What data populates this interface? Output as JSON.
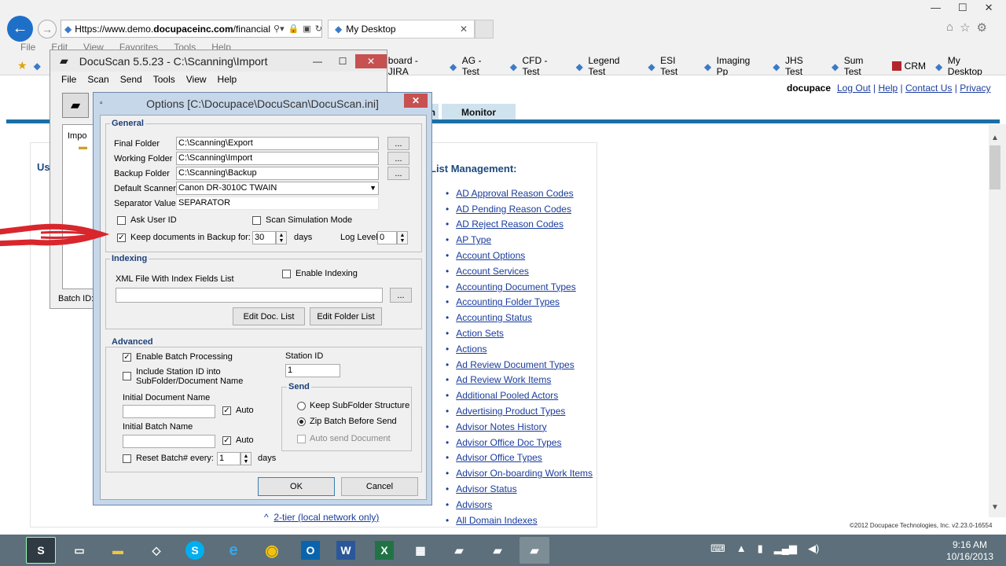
{
  "browser": {
    "address_prefix": "Https://www.demo.",
    "address_domain": "docupaceinc.com",
    "address_suffix": "/financial",
    "tab_title": "My Desktop",
    "menu": [
      "File",
      "Edit",
      "View",
      "Favorites",
      "Tools",
      "Help"
    ],
    "favorites": [
      "board - JIRA",
      "AG - Test",
      "CFD - Test",
      "Legend Test",
      "ESI Test",
      "Imaging Pp",
      "JHS Test",
      "Sum Test",
      "CRM",
      "My Desktop"
    ]
  },
  "page": {
    "brand": "docupace",
    "links": [
      "Log Out",
      "Help",
      "Contact Us",
      "Privacy"
    ],
    "separator": "|",
    "tab_partial": "n",
    "tab_monitor": "Monitor",
    "left_partial": "Us",
    "list_title": "List Management:",
    "list_items": [
      "AD Approval Reason Codes",
      "AD Pending Reason Codes",
      "AD Reject Reason Codes",
      "AP Type",
      "Account Options",
      "Account Services",
      "Accounting Document Types",
      "Accounting Folder Types",
      "Accounting Status",
      "Action Sets",
      "Actions",
      "Ad Review Document Types",
      "Ad Review Work Items",
      "Additional Pooled Actors",
      "Advertising Product Types",
      "Advisor Notes History",
      "Advisor Office Doc Types",
      "Advisor Office Types",
      "Advisor On-boarding Work Items",
      "Advisor Status",
      "Advisors",
      "All Domain Indexes"
    ],
    "two_tier": "2-tier (local network only)",
    "copyright": "©2012 Docupace Technologies, Inc. v2.23.0-16554"
  },
  "docuscan": {
    "title": "DocuScan 5.5.23 - C:\\Scanning\\Import",
    "menu": [
      "File",
      "Scan",
      "Send",
      "Tools",
      "View",
      "Help"
    ],
    "tree_item": "Impo",
    "batch_id": "Batch ID:"
  },
  "options": {
    "title": "Options [C:\\Docupace\\DocuScan\\DocuScan.ini]",
    "general": {
      "label": "General",
      "final_folder_label": "Final Folder",
      "final_folder": "C:\\Scanning\\Export",
      "working_folder_label": "Working Folder",
      "working_folder": "C:\\Scanning\\Import",
      "backup_folder_label": "Backup Folder",
      "backup_folder": "C:\\Scanning\\Backup",
      "default_scanner_label": "Default Scanner",
      "default_scanner": "Canon DR-3010C TWAIN",
      "separator_label": "Separator Value",
      "separator": "SEPARATOR",
      "ask_user_id": "Ask User ID",
      "scan_sim": "Scan Simulation Mode",
      "keep_docs": "Keep documents in Backup for:",
      "keep_days": "30",
      "days": "days",
      "log_level_label": "Log Level",
      "log_level": "0",
      "browse": "..."
    },
    "indexing": {
      "label": "Indexing",
      "xml_label": "XML File With Index Fields List",
      "enable": "Enable Indexing",
      "edit_doc": "Edit Doc. List",
      "edit_folder": "Edit Folder List"
    },
    "advanced": {
      "label": "Advanced",
      "enable_batch": "Enable Batch Processing",
      "include_station_1": "Include Station ID into",
      "include_station_2": "SubFolder/Document Name",
      "station_id_label": "Station ID",
      "station_id": "1",
      "initial_doc_label": "Initial Document Name",
      "auto": "Auto",
      "initial_batch_label": "Initial Batch Name",
      "reset_batch": "Reset Batch#",
      "every": "every:",
      "reset_value": "1",
      "days": "days",
      "send_label": "Send",
      "keep_sub": "Keep SubFolder Structure",
      "zip_batch": "Zip Batch Before Send",
      "auto_send": "Auto send Document"
    },
    "ok": "OK",
    "cancel": "Cancel"
  },
  "taskbar": {
    "time": "9:16 AM",
    "date": "10/16/2013"
  },
  "colors": {
    "link": "#1a3c9c",
    "taskbar": "#5c6f7a",
    "tab_strip": "#1a6fa8",
    "dialog_frame": "#c6d7ea",
    "arrow": "#d8262c"
  }
}
